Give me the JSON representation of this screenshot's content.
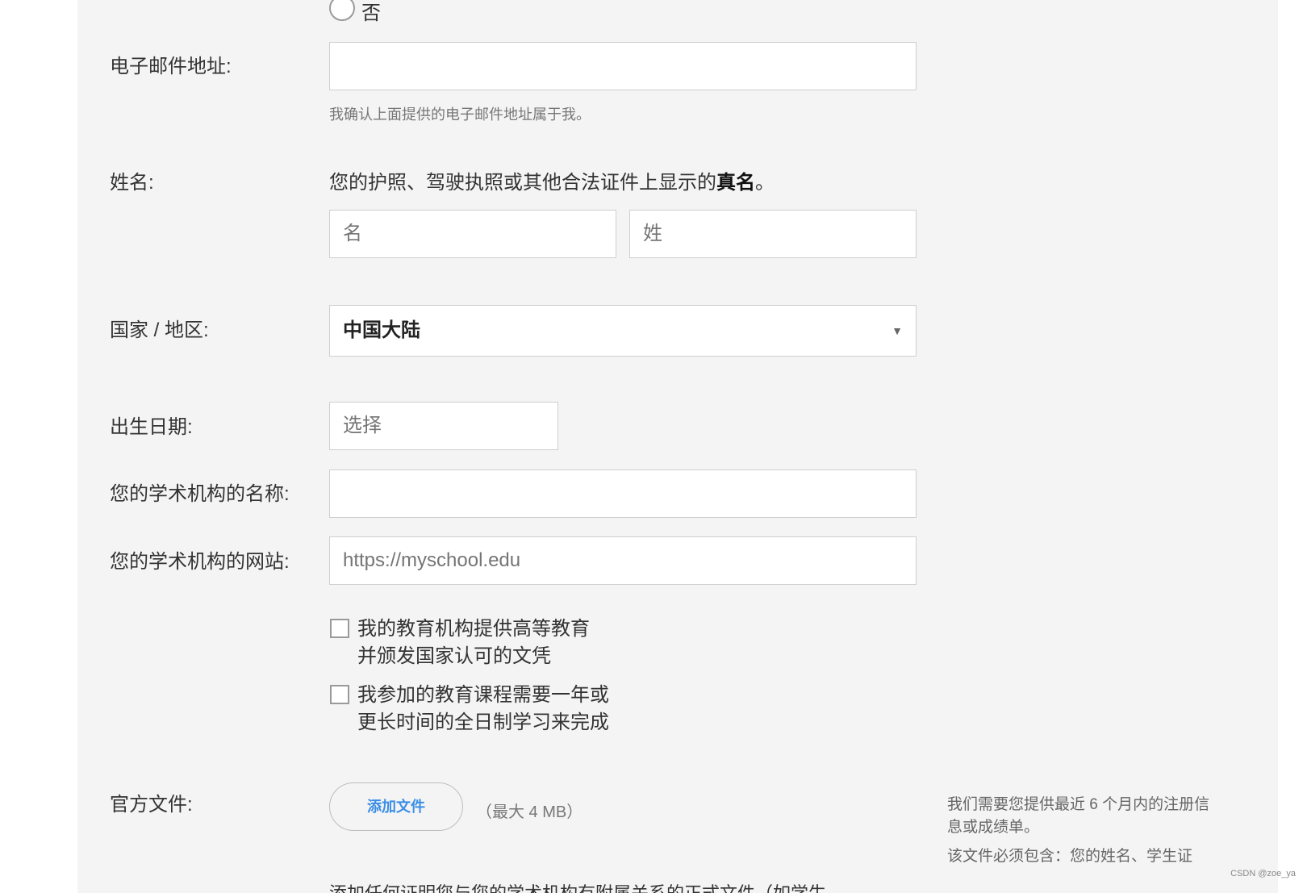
{
  "form": {
    "no_option": "否",
    "email": {
      "label": "电子邮件地址:",
      "value": "",
      "note": "我确认上面提供的电子邮件地址属于我。"
    },
    "name": {
      "label": "姓名:",
      "desc_prefix": "您的护照、驾驶执照或其他合法证件上显示的",
      "desc_bold": "真名",
      "desc_suffix": "。",
      "first_placeholder": "名",
      "last_placeholder": "姓"
    },
    "country": {
      "label": "国家 / 地区:",
      "selected": "中国大陆"
    },
    "dob": {
      "label": "出生日期:",
      "placeholder": "选择"
    },
    "institution_name": {
      "label": "您的学术机构的名称:",
      "value": ""
    },
    "institution_website": {
      "label": "您的学术机构的网站:",
      "placeholder": "https://myschool.edu"
    },
    "checkbox1": {
      "line1": "我的教育机构提供高等教育",
      "line2": "并颁发国家认可的文凭"
    },
    "checkbox2": {
      "line1": "我参加的教育课程需要一年或",
      "line2": "更长时间的全日制学习来完成"
    },
    "docs": {
      "label": "官方文件:",
      "button": "添加文件",
      "max_size": "（最大 4 MB）",
      "bottom_text": "添加任何证明您与您的学术机构有附属关系的正式文件（如学生"
    },
    "side_note": {
      "line1": "我们需要您提供最近 6 个月内的注册信",
      "line2": "息或成绩单。",
      "line3": "该文件必须包含：您的姓名、学生证"
    }
  },
  "watermark": "CSDN @zoe_ya"
}
